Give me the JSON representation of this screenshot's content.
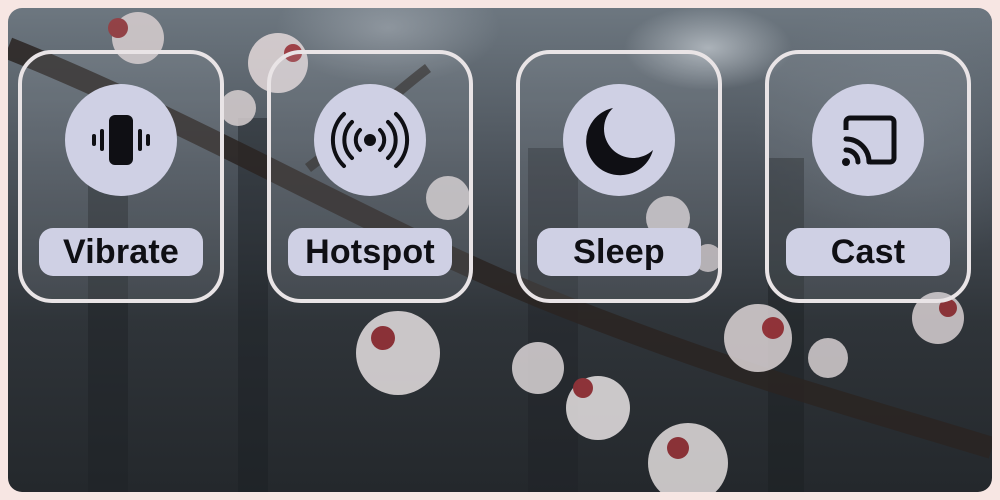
{
  "tiles": [
    {
      "label": "Vibrate",
      "icon": "vibrate-icon"
    },
    {
      "label": "Hotspot",
      "icon": "hotspot-icon"
    },
    {
      "label": "Sleep",
      "icon": "moon-icon"
    },
    {
      "label": "Cast",
      "icon": "cast-icon"
    }
  ],
  "colors": {
    "tile_border": "#e9e4e6",
    "pill_bg": "#cfd0e4",
    "icon_fg": "#0f0f14"
  }
}
